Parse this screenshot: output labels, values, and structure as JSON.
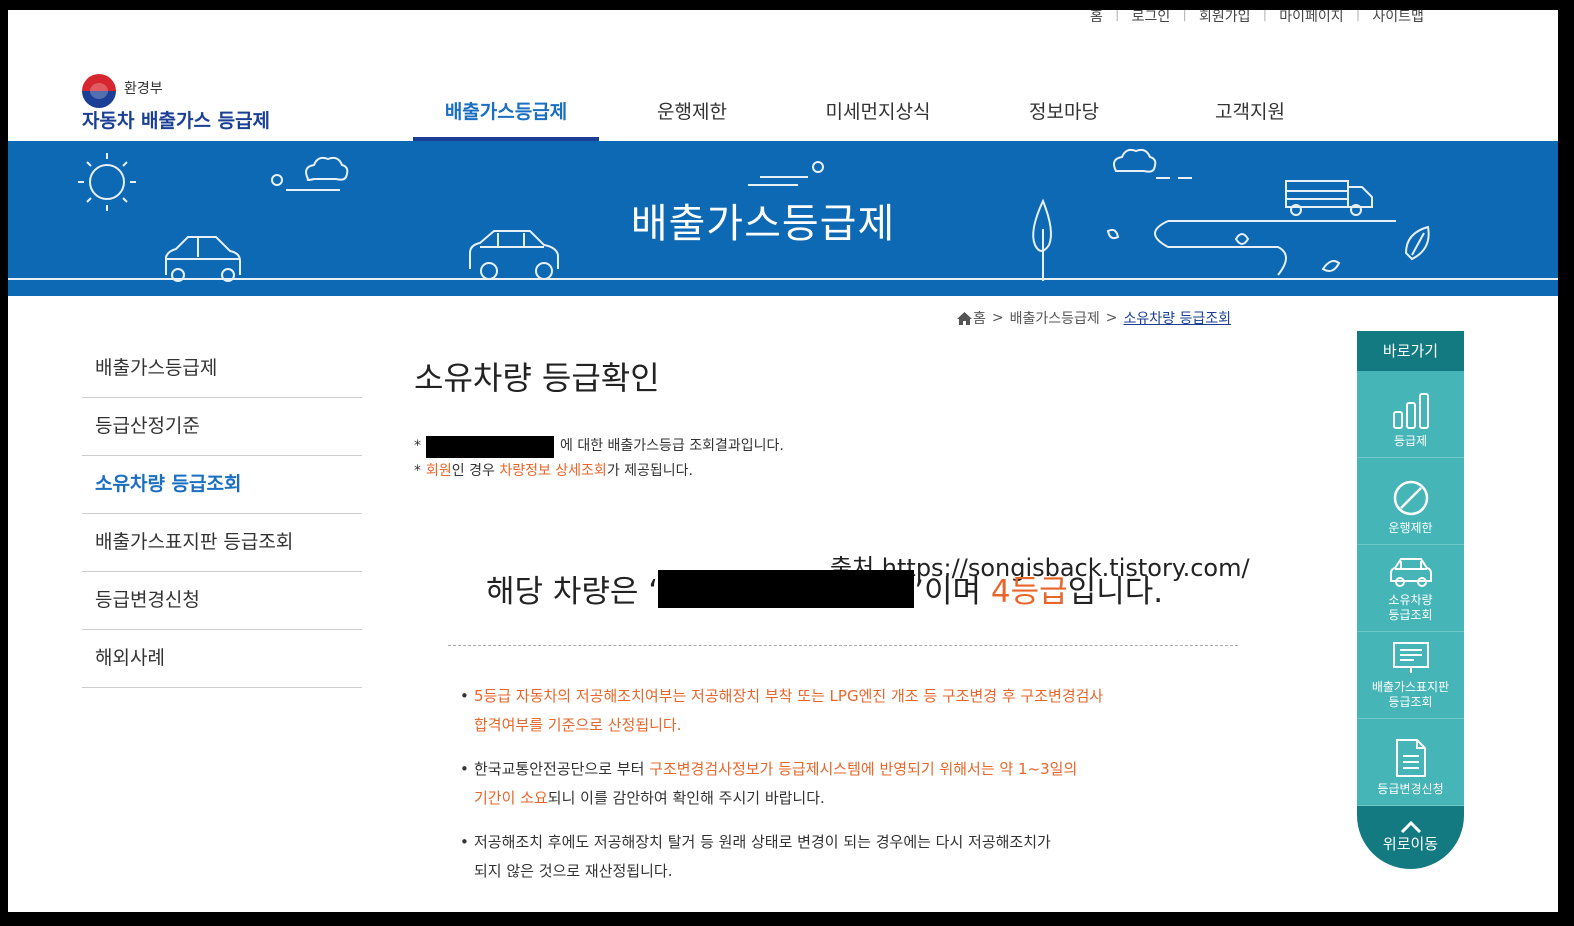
{
  "util_links": [
    "홈",
    "로그인",
    "회원가입",
    "마이페이지",
    "사이트맵"
  ],
  "logo": {
    "ministry": "환경부",
    "service": "자동차 배출가스 등급제"
  },
  "gnb": [
    "배출가스등급제",
    "운행제한",
    "미세먼지상식",
    "정보마당",
    "고객지원"
  ],
  "banner_title": "배출가스등급제",
  "breadcrumb": {
    "home": "홈",
    "level1": "배출가스등급제",
    "current": "소유차량 등급조회"
  },
  "lnb": [
    "배출가스등급제",
    "등급산정기준",
    "소유차량 등급조회",
    "배출가스표지판 등급조회",
    "등급변경신청",
    "해외사례"
  ],
  "content": {
    "title": "소유차량 등급확인",
    "note1_suffix": "에 대한 배출가스등급 조회결과입니다.",
    "note2_member": "회원",
    "note2_mid": "인 경우 ",
    "note2_detail": "차량정보 상세조회",
    "note2_suffix": "가 제공됩니다.",
    "asterisk": "*",
    "result_prefix": "해당 차량은 ‘",
    "result_mid": "’이며 ",
    "result_grade": "4등급",
    "result_suffix": "입니다.",
    "source_text": "출처 https://songisback.tistory.com/",
    "bullet1_line1": "5등급 자동차의 저공해조치여부는 저공해장치 부착 또는 LPG엔진 개조 등 구조변경 후 구조변경검사",
    "bullet1_line2": "합격여부를 기준으로 산정됩니다.",
    "bullet2_a": "한국교통안전공단으로 부터 ",
    "bullet2_b": "구조변경검사정보가 등급제시스템에 반영되기 위해서는 약 1~3일의",
    "bullet2_c": "기간이 소요",
    "bullet2_d": "되니 이를 감안하여 확인해 주시기 바랍니다.",
    "bullet3_line1": "저공해조치 후에도 저공해장치 탈거 등 원래 상태로 변경이 되는 경우에는 다시 저공해조치가",
    "bullet3_line2": "되지 않은 것으로 재산정됩니다."
  },
  "quick": {
    "head": "바로가기",
    "items": [
      "등급제",
      "운행제한",
      "소유차량\n등급조회",
      "배출가스표지판\n등급조회",
      "등급변경신청"
    ],
    "top": "위로이동",
    "icons": [
      "bar-chart-icon",
      "no-entry-icon",
      "car-icon",
      "sign-board-icon",
      "document-icon"
    ]
  },
  "colors": {
    "primary": "#1a3f94",
    "banner": "#0e69b4",
    "accent": "#e8662b",
    "quick_dark": "#147a82",
    "quick_light": "#45b5b7"
  }
}
